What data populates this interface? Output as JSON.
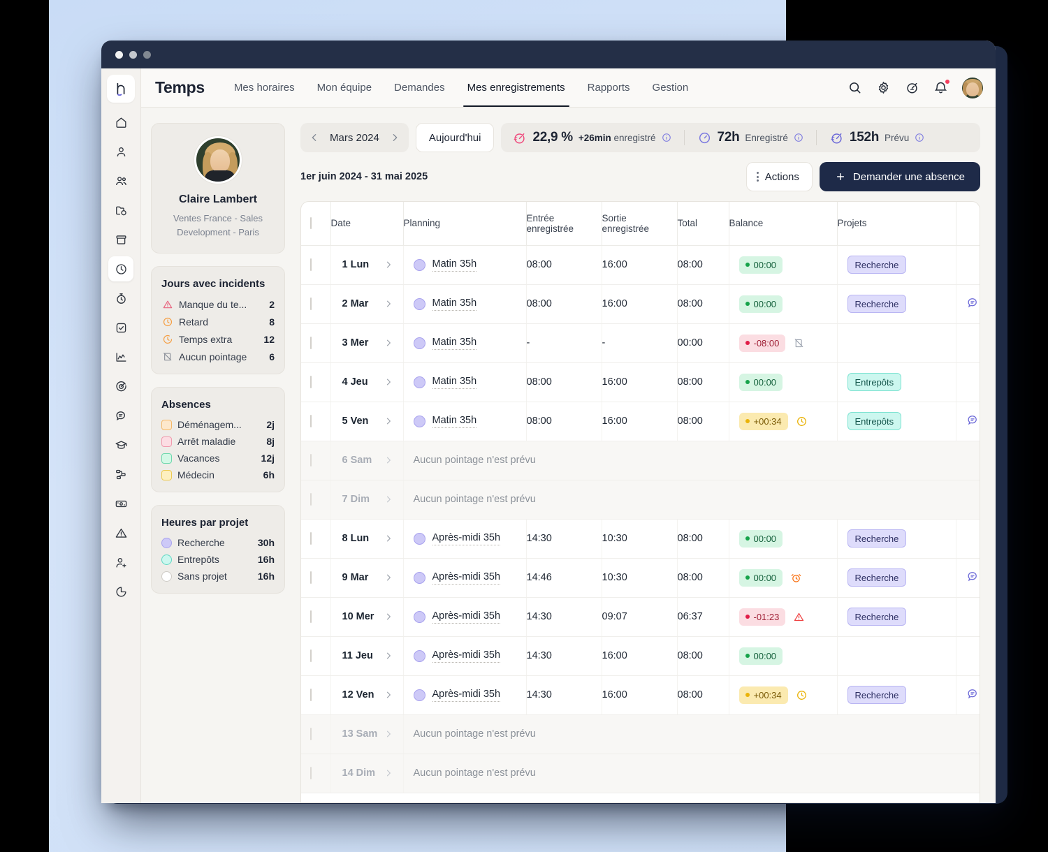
{
  "window": {
    "traffic_lights": [
      "close",
      "minimize",
      "maximize"
    ]
  },
  "nav": {
    "brand": "Temps",
    "tabs": [
      {
        "label": "Mes horaires",
        "active": false
      },
      {
        "label": "Mon équipe",
        "active": false
      },
      {
        "label": "Demandes",
        "active": false
      },
      {
        "label": "Mes enregistrements",
        "active": true
      },
      {
        "label": "Rapports",
        "active": false
      },
      {
        "label": "Gestion",
        "active": false
      }
    ],
    "icons": [
      "search-icon",
      "gear-icon",
      "stopwatch-icon",
      "bell-icon",
      "avatar"
    ]
  },
  "rail": {
    "logo": "humans-logo",
    "items": [
      "home-icon",
      "user-icon",
      "team-icon",
      "folder-icon",
      "archive-icon",
      "clock-icon",
      "stopwatch-icon",
      "check-square-icon",
      "chart-line-icon",
      "target-icon",
      "chat-icon",
      "graduation-cap-icon",
      "flow-icon",
      "payroll-icon",
      "alert-triangle-icon",
      "user-add-icon",
      "pie-chart-icon"
    ],
    "active_index": 5
  },
  "profile": {
    "name": "Claire Lambert",
    "subtitle_line1": "Ventes France - Sales",
    "subtitle_line2": "Development - Paris"
  },
  "incidents": {
    "title": "Jours avec incidents",
    "rows": [
      {
        "icon": "alert-triangle-icon",
        "color": "#e8647f",
        "label": "Manque du te...",
        "value": "2"
      },
      {
        "icon": "clock-icon",
        "color": "#f59e42",
        "label": "Retard",
        "value": "8"
      },
      {
        "icon": "clock-extra-icon",
        "color": "#f59e42",
        "label": "Temps extra",
        "value": "12"
      },
      {
        "icon": "no-punch-icon",
        "color": "#8a8f98",
        "label": "Aucun pointage",
        "value": "6"
      }
    ]
  },
  "absences": {
    "title": "Absences",
    "rows": [
      {
        "label": "Déménagem...",
        "value": "2j",
        "fill": "#fde8cc",
        "stroke": "#f5b969"
      },
      {
        "label": "Arrêt maladie",
        "value": "8j",
        "fill": "#fcdde3",
        "stroke": "#f09bae"
      },
      {
        "label": "Vacances",
        "value": "12j",
        "fill": "#d3f8e6",
        "stroke": "#6fd8ad"
      },
      {
        "label": "Médecin",
        "value": "6h",
        "fill": "#fdf0c0",
        "stroke": "#edcb52"
      }
    ]
  },
  "project_hours": {
    "title": "Heures par projet",
    "rows": [
      {
        "label": "Recherche",
        "value": "30h",
        "fill": "#cdc9f7",
        "stroke": "#a8a2ee"
      },
      {
        "label": "Entrepôts",
        "value": "16h",
        "fill": "#ccf7ef",
        "stroke": "#5fd9c4"
      },
      {
        "label": "Sans projet",
        "value": "16h",
        "fill": "#ffffff",
        "stroke": "#cfccc6"
      }
    ]
  },
  "toolbar": {
    "prev_icon": "chevron-left-icon",
    "next_icon": "chevron-right-icon",
    "month": "Mars 2024",
    "today_label": "Aujourd'hui",
    "stats": [
      {
        "icon": "stopwatch-pink-icon",
        "value": "22,9 %",
        "delta": "+26min",
        "label": "enregistré",
        "info": true
      },
      {
        "icon": "clock-purple-icon",
        "value": "72h",
        "label": "Enregistré",
        "info": true
      },
      {
        "icon": "speedometer-purple-icon",
        "value": "152h",
        "label": "Prévu",
        "info": true
      }
    ]
  },
  "subbar": {
    "date_range": "1er juin 2024 - 31 mai 2025",
    "actions_label": "Actions",
    "primary_label": "Demander une absence",
    "primary_icon": "plus-icon"
  },
  "table": {
    "headers": [
      "",
      "Date",
      "Planning",
      "Entrée enregistrée",
      "Sortie enregistrée",
      "Total",
      "Balance",
      "Projets",
      ""
    ],
    "headers_split": [
      {
        "l1": "",
        "l2": ""
      },
      {
        "l1": "Date",
        "l2": ""
      },
      {
        "l1": "Planning",
        "l2": ""
      },
      {
        "l1": "Entrée",
        "l2": "enregistrée"
      },
      {
        "l1": "Sortie",
        "l2": "enregistrée"
      },
      {
        "l1": "Total",
        "l2": ""
      },
      {
        "l1": "Balance",
        "l2": ""
      },
      {
        "l1": "Projets",
        "l2": ""
      },
      {
        "l1": "",
        "l2": ""
      }
    ],
    "empty_text": "Aucun pointage n'est prévu",
    "rows": [
      {
        "date": "1 Lun",
        "empty": false,
        "planning": "Matin 35h",
        "in": "08:00",
        "out": "16:00",
        "total": "08:00",
        "balance": "00:00",
        "balance_kind": "ok",
        "status_icon": "",
        "project": "Recherche",
        "project_kind": "recherche",
        "note": false
      },
      {
        "date": "2 Mar",
        "empty": false,
        "planning": "Matin 35h",
        "in": "08:00",
        "out": "16:00",
        "total": "08:00",
        "balance": "00:00",
        "balance_kind": "ok",
        "status_icon": "",
        "project": "Recherche",
        "project_kind": "recherche",
        "note": true
      },
      {
        "date": "3 Mer",
        "empty": false,
        "planning": "Matin 35h",
        "in": "-",
        "out": "-",
        "total": "00:00",
        "balance": "-08:00",
        "balance_kind": "neg",
        "status_icon": "no-punch-icon",
        "project": "",
        "project_kind": "",
        "note": false
      },
      {
        "date": "4 Jeu",
        "empty": false,
        "planning": "Matin 35h",
        "in": "08:00",
        "out": "16:00",
        "total": "08:00",
        "balance": "00:00",
        "balance_kind": "ok",
        "status_icon": "",
        "project": "Entrepôts",
        "project_kind": "entrepots",
        "note": false
      },
      {
        "date": "5 Ven",
        "empty": false,
        "planning": "Matin 35h",
        "in": "08:00",
        "out": "16:00",
        "total": "08:00",
        "balance": "+00:34",
        "balance_kind": "warn",
        "status_icon": "clock-yellow-icon",
        "project": "Entrepôts",
        "project_kind": "entrepots",
        "note": true
      },
      {
        "date": "6 Sam",
        "empty": true
      },
      {
        "date": "7 Dim",
        "empty": true
      },
      {
        "date": "8 Lun",
        "empty": false,
        "planning": "Après-midi 35h",
        "in": "14:30",
        "out": "10:30",
        "total": "08:00",
        "balance": "00:00",
        "balance_kind": "ok",
        "status_icon": "",
        "project": "Recherche",
        "project_kind": "recherche",
        "note": false
      },
      {
        "date": "9 Mar",
        "empty": false,
        "planning": "Après-midi 35h",
        "in": "14:46",
        "out": "10:30",
        "total": "08:00",
        "balance": "00:00",
        "balance_kind": "ok",
        "status_icon": "alarm-icon",
        "project": "Recherche",
        "project_kind": "recherche",
        "note": true
      },
      {
        "date": "10 Mer",
        "empty": false,
        "planning": "Après-midi 35h",
        "in": "14:30",
        "out": "09:07",
        "total": "06:37",
        "balance": "-01:23",
        "balance_kind": "neg",
        "status_icon": "warn-icon",
        "project": "Recherche",
        "project_kind": "recherche",
        "note": false
      },
      {
        "date": "11 Jeu",
        "empty": false,
        "planning": "Après-midi 35h",
        "in": "14:30",
        "out": "16:00",
        "total": "08:00",
        "balance": "00:00",
        "balance_kind": "ok",
        "status_icon": "",
        "project": "",
        "project_kind": "",
        "note": false
      },
      {
        "date": "12 Ven",
        "empty": false,
        "planning": "Après-midi 35h",
        "in": "14:30",
        "out": "16:00",
        "total": "08:00",
        "balance": "+00:34",
        "balance_kind": "warn",
        "status_icon": "clock-yellow-icon",
        "project": "Recherche",
        "project_kind": "recherche",
        "note": true
      },
      {
        "date": "13 Sam",
        "empty": true
      },
      {
        "date": "14 Dim",
        "empty": true
      }
    ]
  },
  "colors": {
    "accent_dark": "#1e2a48",
    "accent_purple": "#6c69d8",
    "ok": "#16a34a",
    "neg": "#e11d48",
    "warn": "#eab308",
    "backdrop": "#cfe0f7"
  }
}
